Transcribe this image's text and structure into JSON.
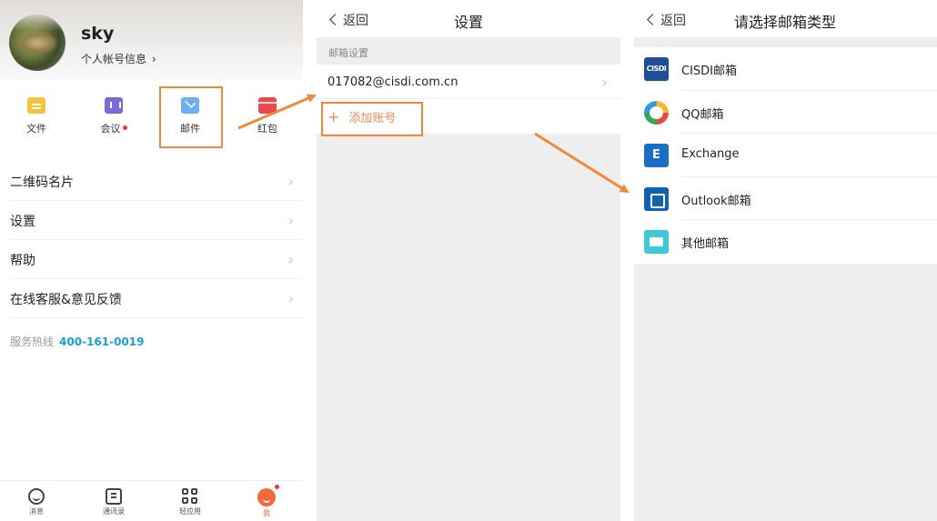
{
  "profile": {
    "username": "sky",
    "info_link": "个人帐号信息"
  },
  "shortcuts": [
    {
      "label": "文件",
      "icon": "folder-icon"
    },
    {
      "label": "会议",
      "icon": "meeting-icon"
    },
    {
      "label": "邮件",
      "icon": "mail-icon"
    },
    {
      "label": "红包",
      "icon": "red-packet-icon"
    }
  ],
  "menu": [
    {
      "label": "二维码名片"
    },
    {
      "label": "设置"
    },
    {
      "label": "帮助"
    },
    {
      "label": "在线客服&意见反馈"
    }
  ],
  "hotline": {
    "label": "服务热线",
    "number": "400-161-0019"
  },
  "tabbar": [
    {
      "label": "消息",
      "icon": "message-icon"
    },
    {
      "label": "通讯录",
      "icon": "contacts-icon"
    },
    {
      "label": "轻应用",
      "icon": "apps-icon"
    },
    {
      "label": "我",
      "icon": "me-icon"
    }
  ],
  "settings_screen": {
    "back_label": "返回",
    "title": "设置",
    "section_label": "邮箱设置",
    "account": "017082@cisdi.com.cn",
    "add_label": "添加账号"
  },
  "mail_type_screen": {
    "back_label": "返回",
    "title": "请选择邮箱类型",
    "options": [
      {
        "label": "CISDI邮箱",
        "icon": "cisdi-mail-icon",
        "icon_text": "CISDI"
      },
      {
        "label": "QQ邮箱",
        "icon": "qq-mail-icon"
      },
      {
        "label": "Exchange",
        "icon": "exchange-icon",
        "icon_text": "E"
      },
      {
        "label": "Outlook邮箱",
        "icon": "outlook-icon"
      },
      {
        "label": "其他邮箱",
        "icon": "other-mail-icon"
      }
    ]
  },
  "colors": {
    "accent_orange": "#f0893a",
    "hotline_blue": "#1aa0d2",
    "add_text": "#f08a5a"
  }
}
